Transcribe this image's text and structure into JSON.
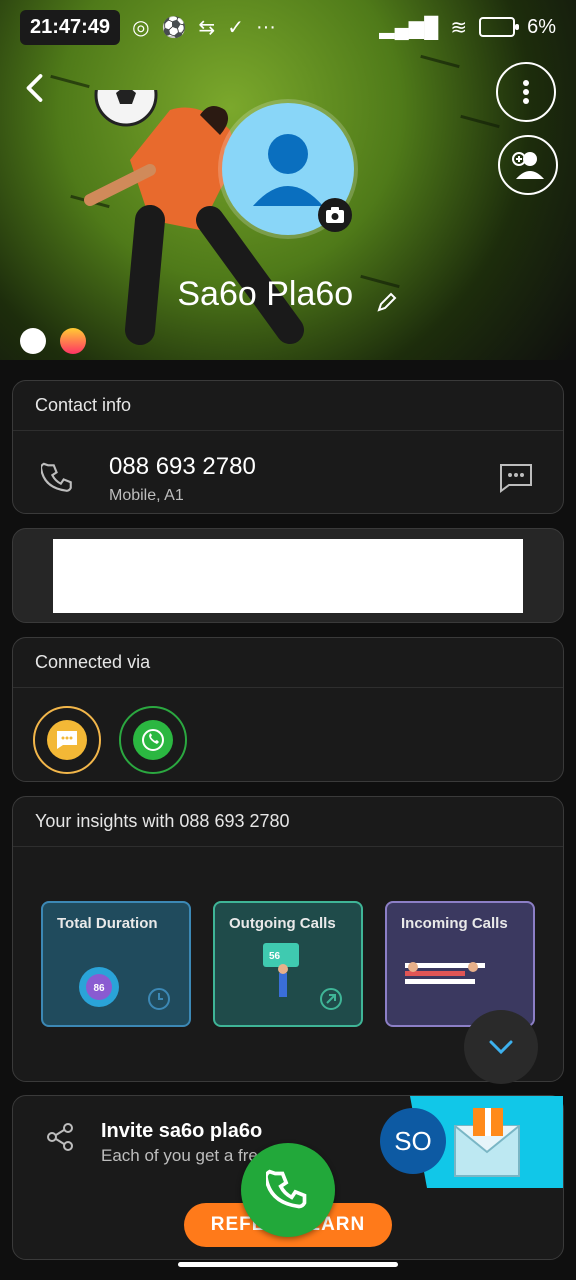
{
  "status_bar": {
    "time": "21:47:49",
    "icons": [
      "whatsapp-icon",
      "clock-icon",
      "soccer-icon",
      "sim-icon",
      "check-icon",
      "more-icon"
    ],
    "battery_percent": "6%"
  },
  "profile": {
    "name": "Sa6o Pla6o",
    "accent_colors": [
      "#ffffff",
      "#ff3366"
    ]
  },
  "contact_info": {
    "title": "Contact info",
    "phone_number": "088 693 2780",
    "phone_label": "Mobile, A1"
  },
  "connected_via": {
    "title": "Connected via",
    "apps": [
      "messages",
      "whatsapp"
    ]
  },
  "insights": {
    "title": "Your insights with 088 693 2780",
    "tiles": [
      {
        "label": "Total Duration",
        "value": "86"
      },
      {
        "label": "Outgoing Calls",
        "value": "56"
      },
      {
        "label": "Incoming Calls"
      }
    ]
  },
  "invite": {
    "title": "Invite sa6o pla6o",
    "subtitle": "Each of you get a fre",
    "refer_label": "REFER & EARN",
    "badge_initials": "SO"
  },
  "colors": {
    "accent_orange": "#ff7a1a",
    "call_green": "#22a83a",
    "avatar_blue": "#89d6f8"
  }
}
